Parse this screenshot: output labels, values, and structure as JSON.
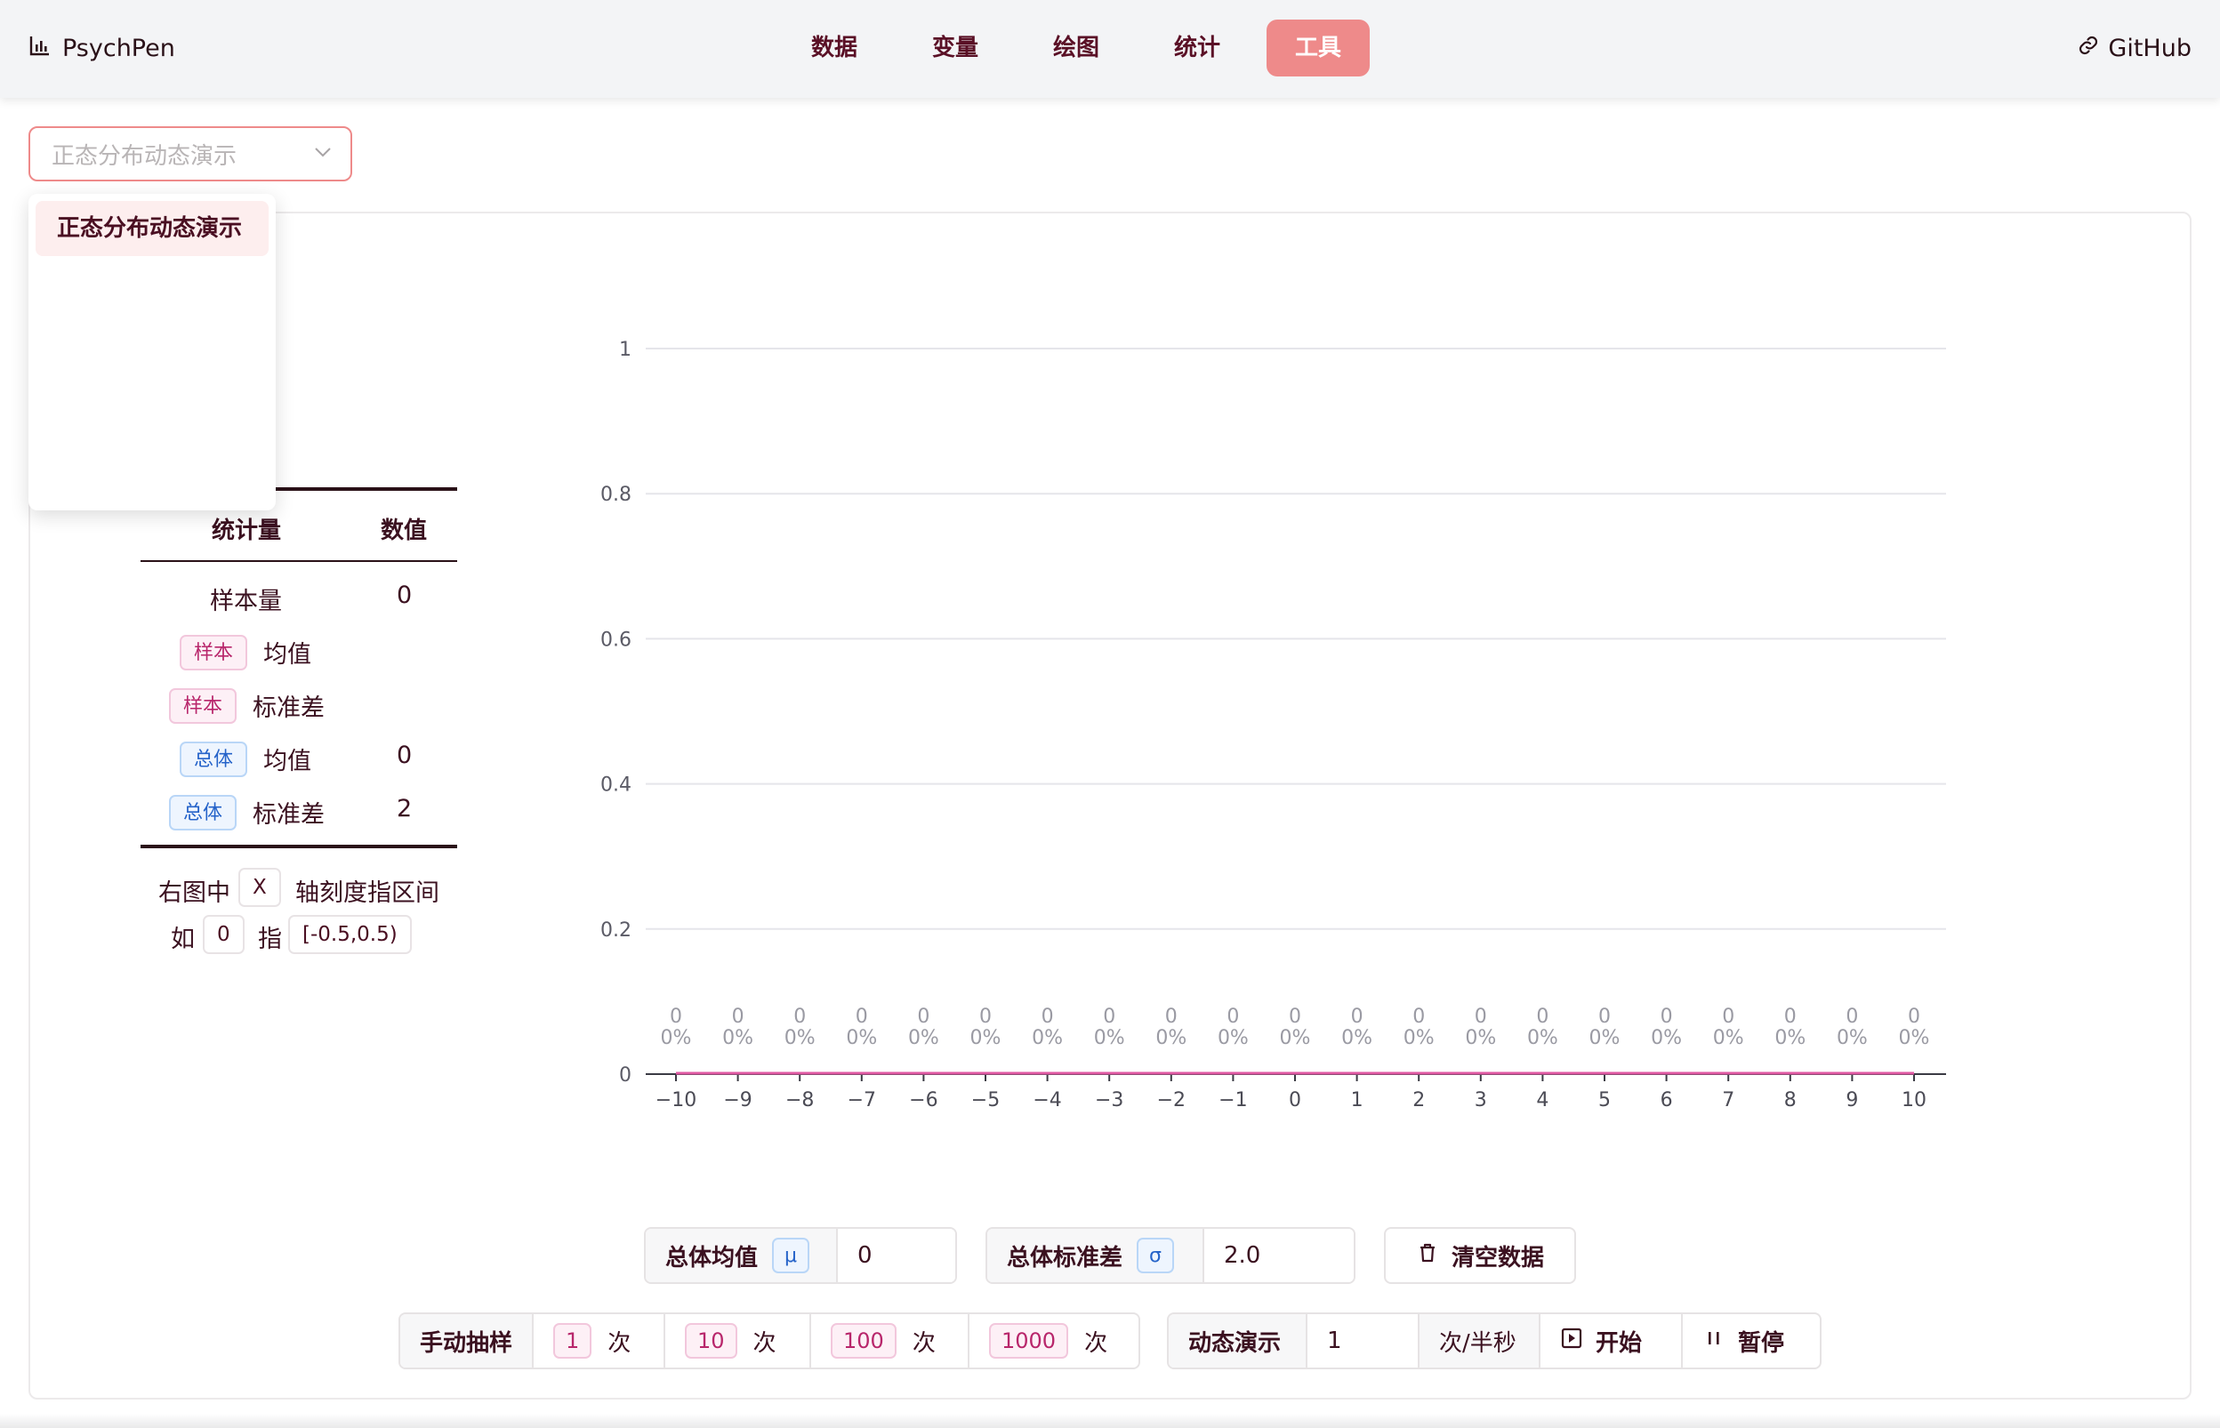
{
  "nav": {
    "brand": "PsychPen",
    "items": [
      "数据",
      "变量",
      "绘图",
      "统计",
      "工具"
    ],
    "active_index": 4,
    "github": "GitHub"
  },
  "tool_select": {
    "value": "正态分布动态演示",
    "options": [
      "正态分布动态演示"
    ]
  },
  "stats_table": {
    "header": {
      "name": "统计量",
      "value": "数值"
    },
    "sample_size": {
      "label": "样本量",
      "value": "0"
    },
    "sample_mean": {
      "tag": "样本",
      "label": "均值",
      "value": ""
    },
    "sample_sd": {
      "tag": "样本",
      "label": "标准差",
      "value": ""
    },
    "pop_mean": {
      "tag": "总体",
      "label": "均值",
      "value": "0"
    },
    "pop_sd": {
      "tag": "总体",
      "label": "标准差",
      "value": "2"
    }
  },
  "axis_note": {
    "part1": "右图中",
    "axis": "X",
    "part2": "轴刻度指区间",
    "example_prefix": "如",
    "example_value": "0",
    "example_mid": "指",
    "example_interval": "[-0.5,0.5)"
  },
  "chart_data": {
    "type": "bar",
    "categories": [
      "−10",
      "−9",
      "−8",
      "−7",
      "−6",
      "−5",
      "−4",
      "−3",
      "−2",
      "−1",
      "0",
      "1",
      "2",
      "3",
      "4",
      "5",
      "6",
      "7",
      "8",
      "9",
      "10"
    ],
    "values": [
      0,
      0,
      0,
      0,
      0,
      0,
      0,
      0,
      0,
      0,
      0,
      0,
      0,
      0,
      0,
      0,
      0,
      0,
      0,
      0,
      0
    ],
    "bar_labels_count": [
      "0",
      "0",
      "0",
      "0",
      "0",
      "0",
      "0",
      "0",
      "0",
      "0",
      "0",
      "0",
      "0",
      "0",
      "0",
      "0",
      "0",
      "0",
      "0",
      "0",
      "0"
    ],
    "bar_labels_pct": [
      "0%",
      "0%",
      "0%",
      "0%",
      "0%",
      "0%",
      "0%",
      "0%",
      "0%",
      "0%",
      "0%",
      "0%",
      "0%",
      "0%",
      "0%",
      "0%",
      "0%",
      "0%",
      "0%",
      "0%",
      "0%"
    ],
    "ylim": [
      0,
      1
    ],
    "yticks": [
      0,
      0.2,
      0.4,
      0.6,
      0.8,
      1
    ],
    "ytick_labels": [
      "0",
      "0.2",
      "0.4",
      "0.6",
      "0.8",
      "1"
    ],
    "grid": true,
    "line_color": "#e05aa3",
    "gridline_color": "#e5e5ea"
  },
  "controls": {
    "pop_mean": {
      "label": "总体均值",
      "symbol": "μ",
      "value": "0"
    },
    "pop_sd": {
      "label": "总体标准差",
      "symbol": "σ",
      "value": "2.0"
    },
    "clear": "清空数据",
    "manual": {
      "label": "手动抽样",
      "options": [
        {
          "n": "1",
          "unit": "次"
        },
        {
          "n": "10",
          "unit": "次"
        },
        {
          "n": "100",
          "unit": "次"
        },
        {
          "n": "1000",
          "unit": "次"
        }
      ]
    },
    "demo": {
      "label": "动态演示",
      "value": "1",
      "unit": "次/半秒",
      "start": "开始",
      "pause": "暂停"
    }
  },
  "colors": {
    "accent": "#ee8a8a",
    "text": "#3b1120",
    "pink_tag": "#b8266b",
    "blue_tag": "#2563c9"
  }
}
